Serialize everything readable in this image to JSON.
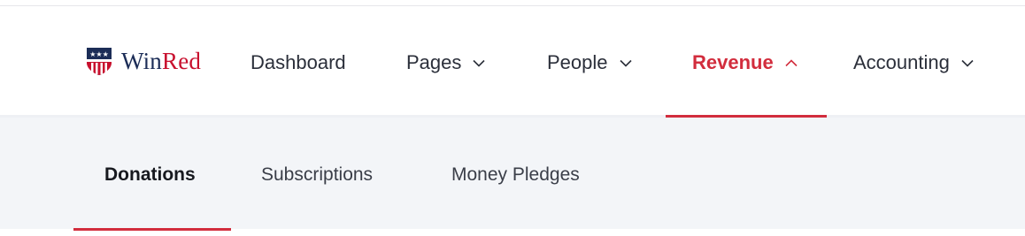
{
  "brand": {
    "name_part1": "Win",
    "name_part2": "Red",
    "logo_icon": "shield-flag-icon",
    "colors": {
      "navy": "#1c2d57",
      "red": "#c8102e"
    }
  },
  "nav": {
    "items": [
      {
        "label": "Dashboard",
        "has_chevron": false
      },
      {
        "label": "Pages",
        "chevron": "down"
      },
      {
        "label": "People",
        "chevron": "down"
      },
      {
        "label": "Revenue",
        "chevron": "up",
        "active": true
      },
      {
        "label": "Accounting",
        "chevron": "down"
      }
    ],
    "active_color": "#d22d3d"
  },
  "subnav": {
    "items": [
      {
        "label": "Donations",
        "active": true
      },
      {
        "label": "Subscriptions"
      },
      {
        "label": "Money Pledges"
      }
    ],
    "background": "#f3f5f8"
  }
}
